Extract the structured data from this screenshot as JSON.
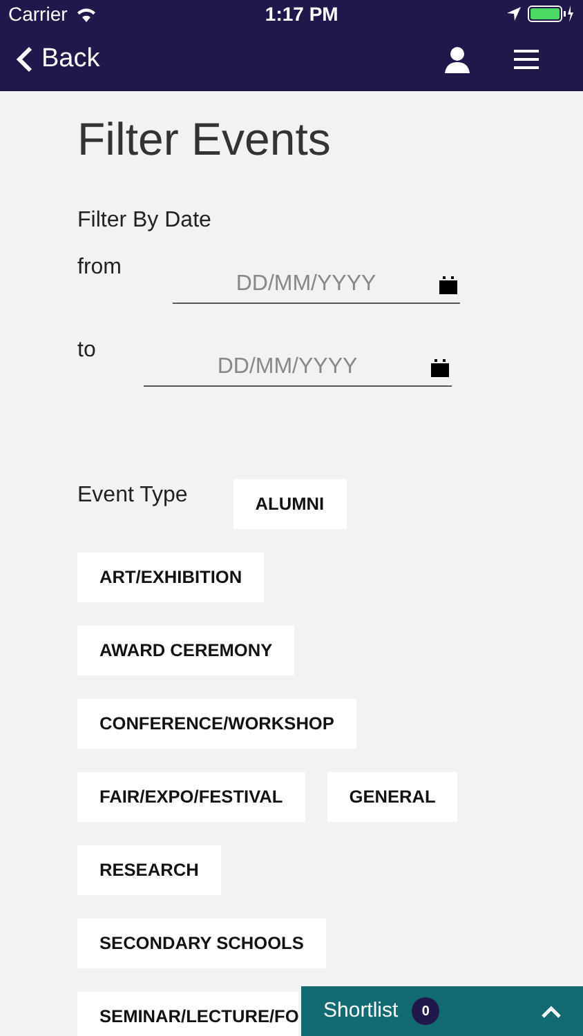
{
  "status_bar": {
    "carrier": "Carrier",
    "time": "1:17 PM"
  },
  "nav": {
    "back": "Back"
  },
  "title": "Filter Events",
  "date_filter": {
    "label": "Filter By Date",
    "fields": [
      {
        "label": "from",
        "placeholder": "DD/MM/YYYY"
      },
      {
        "label": "to",
        "placeholder": "DD/MM/YYYY"
      }
    ]
  },
  "event_type": {
    "label": "Event Type",
    "options": [
      "ALUMNI",
      "ART/EXHIBITION",
      "AWARD CEREMONY",
      "CONFERENCE/WORKSHOP",
      "FAIR/EXPO/FESTIVAL",
      "GENERAL",
      "RESEARCH",
      "SECONDARY SCHOOLS",
      "SEMINAR/LECTURE/FO"
    ]
  },
  "shortlist": {
    "label": "Shortlist",
    "count": "0"
  }
}
